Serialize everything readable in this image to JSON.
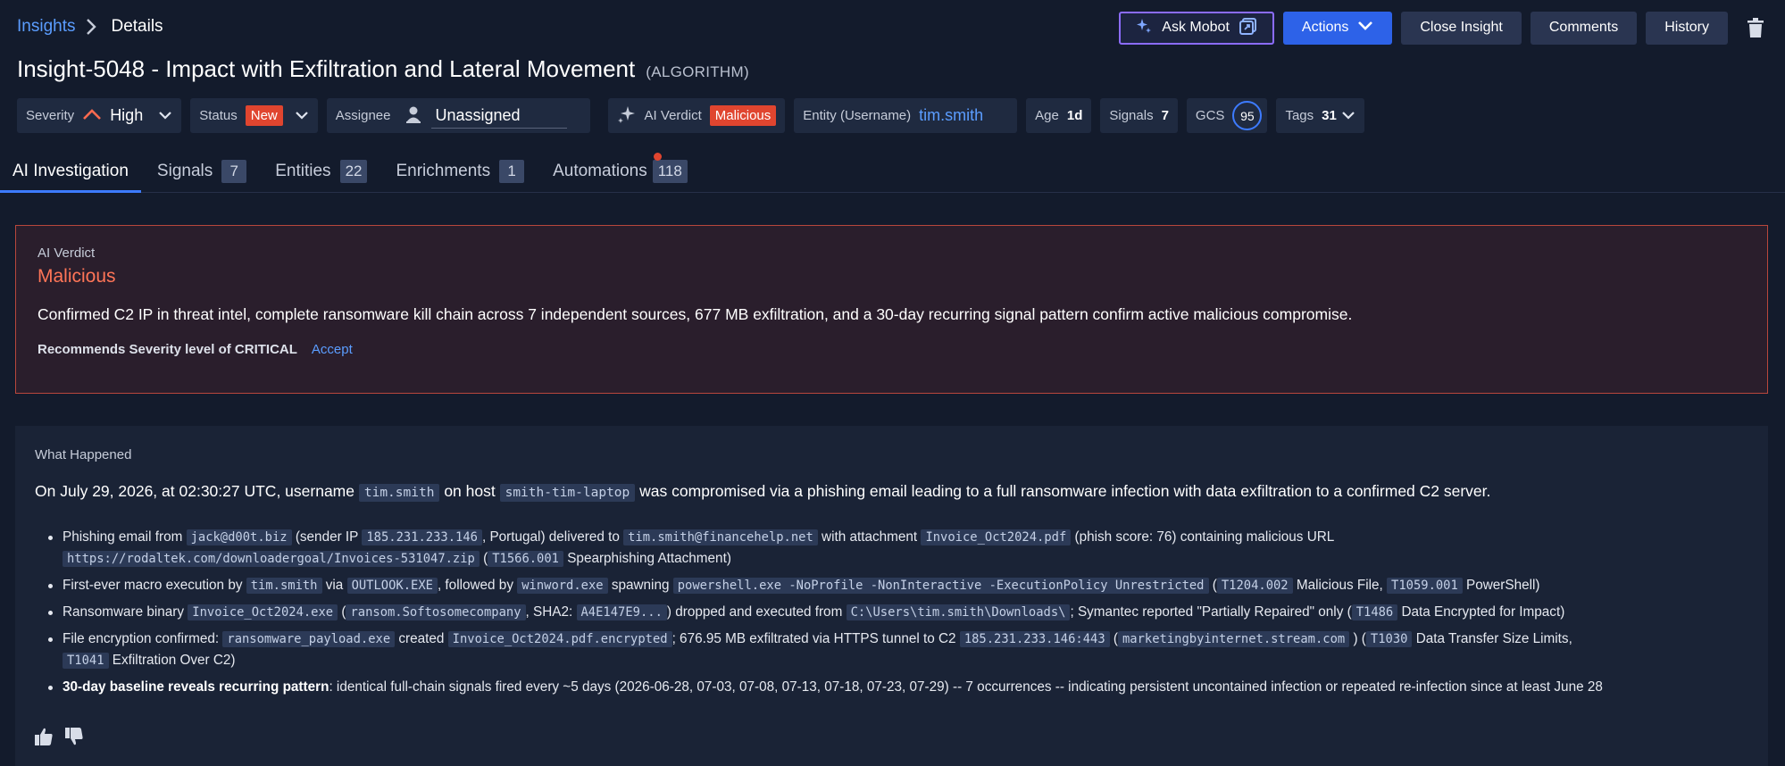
{
  "breadcrumb": {
    "root": "Insights",
    "current": "Details"
  },
  "toolbar": {
    "ask_mobot": "Ask Mobot",
    "actions": "Actions",
    "close_insight": "Close Insight",
    "comments": "Comments",
    "history": "History"
  },
  "insight": {
    "title": "Insight-5048 - Impact with Exfiltration and Lateral Movement",
    "source": "(ALGORITHM)"
  },
  "meta": {
    "severity_label": "Severity",
    "severity_value": "High",
    "status_label": "Status",
    "status_value": "New",
    "assignee_label": "Assignee",
    "assignee_value": "Unassigned",
    "ai_verdict_label": "AI Verdict",
    "ai_verdict_value": "Malicious",
    "entity_label": "Entity (Username)",
    "entity_value": "tim.smith",
    "age_label": "Age",
    "age_value": "1d",
    "signals_label": "Signals",
    "signals_value": "7",
    "gcs_label": "GCS",
    "gcs_value": "95",
    "tags_label": "Tags",
    "tags_value": "31"
  },
  "tabs": [
    {
      "label": "AI Investigation",
      "count": ""
    },
    {
      "label": "Signals",
      "count": "7"
    },
    {
      "label": "Entities",
      "count": "22"
    },
    {
      "label": "Enrichments",
      "count": "1"
    },
    {
      "label": "Automations",
      "count": "118"
    }
  ],
  "verdict": {
    "label": "AI Verdict",
    "value": "Malicious",
    "description": "Confirmed C2 IP in threat intel, complete ransomware kill chain across 7 independent sources, 677 MB exfiltration, and a 30-day recurring signal pattern confirm active malicious compromise.",
    "recommendation": "Recommends Severity level of CRITICAL",
    "accept": "Accept"
  },
  "happened": {
    "label": "What Happened",
    "summary": {
      "t1": "On July 29, 2026, at 02:30:27 UTC, username",
      "c1": "tim.smith",
      "t2": "on host",
      "c2": "smith-tim-laptop",
      "t3": "was compromised via a phishing email leading to a full ransomware infection with data exfiltration to a confirmed C2 server."
    },
    "b1": {
      "t1": "Phishing email from",
      "c1": "jack@d00t.biz",
      "t2": "(sender IP",
      "c2": "185.231.233.146",
      "t3": ", Portugal) delivered to",
      "c3": "tim.smith@financehelp.net",
      "t4": "with attachment",
      "c4": "Invoice_Oct2024.pdf",
      "t5": "(phish score: 76) containing malicious URL",
      "c5": "https://rodaltek.com/downloadergoal/Invoices-531047.zip",
      "t6": "(",
      "c6": "T1566.001",
      "t7": "Spearphishing Attachment)"
    },
    "b2": {
      "t1": "First-ever macro execution by",
      "c1": "tim.smith",
      "t2": "via",
      "c2": "OUTLOOK.EXE",
      "t3": ", followed by",
      "c3": "winword.exe",
      "t4": "spawning",
      "c4": "powershell.exe -NoProfile -NonInteractive -ExecutionPolicy Unrestricted",
      "t5": "(",
      "c5": "T1204.002",
      "t6": "Malicious File,",
      "c6": "T1059.001",
      "t7": "PowerShell)"
    },
    "b3": {
      "t1": "Ransomware binary",
      "c1": "Invoice_Oct2024.exe",
      "t2": "(",
      "c2": "ransom.Softosomecompany",
      "t3": ", SHA2:",
      "c3": "A4E147E9...",
      "t4": ") dropped and executed from",
      "c4": "C:\\Users\\tim.smith\\Downloads\\",
      "t5": "; Symantec reported \"Partially Repaired\" only (",
      "c5": "T1486",
      "t6": "Data Encrypted for Impact)"
    },
    "b4": {
      "t1": "File encryption confirmed:",
      "c1": "ransomware_payload.exe",
      "t2": "created",
      "c2": "Invoice_Oct2024.pdf.encrypted",
      "t3": "; 676.95 MB exfiltrated via HTTPS tunnel to C2",
      "c3": "185.231.233.146:443",
      "t4": "(",
      "c4": "marketingbyinternet.stream.com",
      "t5": ") (",
      "c5": "T1030",
      "t6": "Data Transfer Size Limits,",
      "c6": "T1041",
      "t7": "Exfiltration Over C2)"
    },
    "b5": {
      "strong": "30-day baseline reveals recurring pattern",
      "t1": ": identical full-chain signals fired every ~5 days (2026-06-28, 07-03, 07-08, 07-13, 07-18, 07-23, 07-29) -- 7 occurrences -- indicating persistent uncontained infection or repeated re-infection since at least June 28"
    }
  },
  "colors": {
    "accent": "#3d7bff",
    "danger": "#e0452f",
    "verdict_text": "#ff7557",
    "background": "#131b2c"
  },
  "icons": [
    "chevron-right-icon",
    "sparkle-icon",
    "external-link-icon",
    "chevron-down-icon",
    "trash-icon",
    "severity-up-icon",
    "user-icon",
    "ai-sparkle-icon",
    "thumbs-up-icon",
    "thumbs-down-icon"
  ]
}
